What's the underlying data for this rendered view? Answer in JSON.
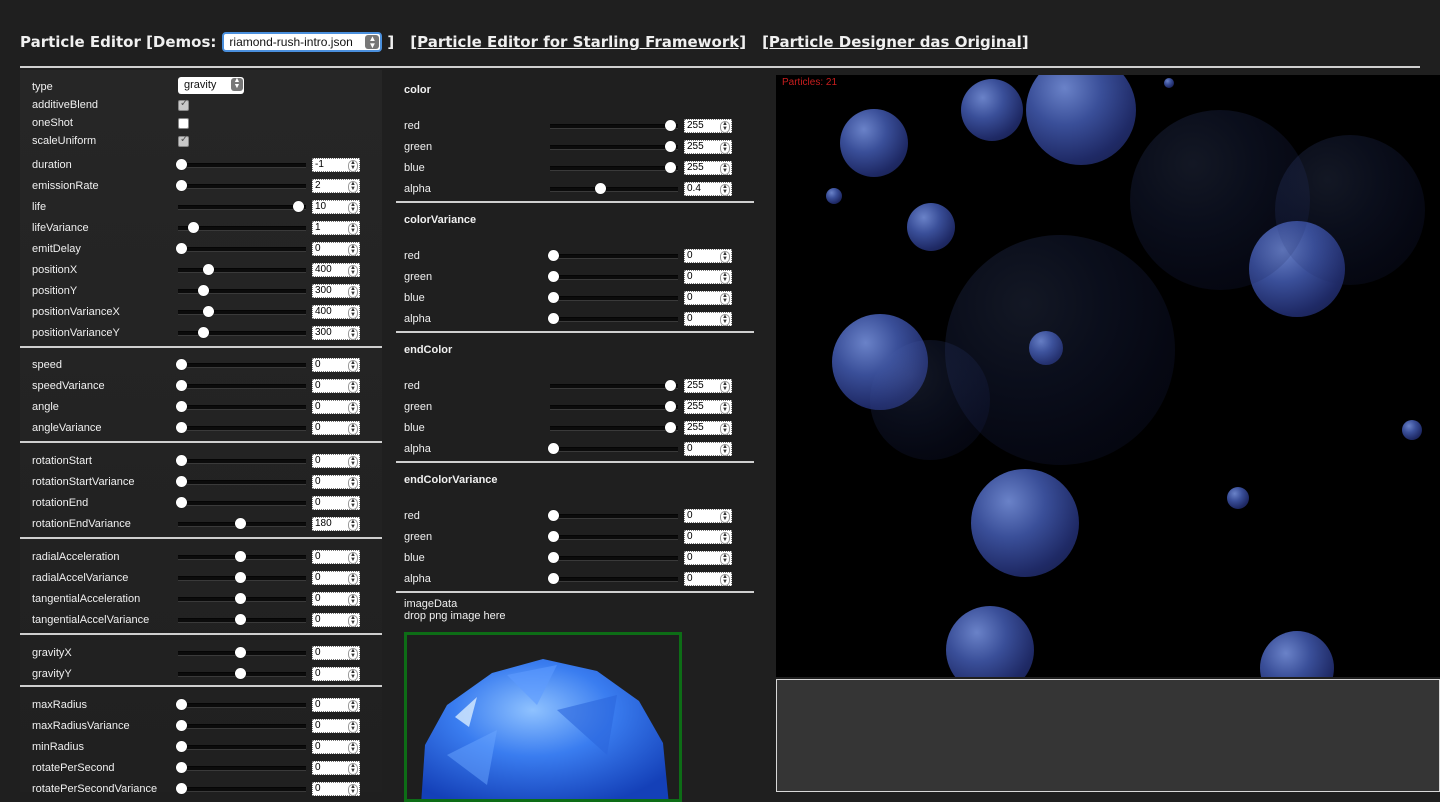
{
  "header": {
    "title_prefix": "Particle Editor [Demos:",
    "demo_selected": "riamond-rush-intro.json",
    "close_bracket": "]",
    "link1": "[Particle Editor for Starling Framework]",
    "link2": "[Particle Designer das Original]"
  },
  "left": {
    "type": {
      "label": "type",
      "value": "gravity"
    },
    "checks": [
      {
        "label": "additiveBlend",
        "checked": true
      },
      {
        "label": "oneShot",
        "checked": false
      },
      {
        "label": "scaleUniform",
        "checked": true
      }
    ],
    "groups": [
      [
        {
          "label": "duration",
          "value": "-1",
          "slider": 0.0
        },
        {
          "label": "emissionRate",
          "value": "2",
          "slider": 0.0
        },
        {
          "label": "life",
          "value": "10",
          "slider": 1.0
        },
        {
          "label": "lifeVariance",
          "value": "1",
          "slider": 0.1
        },
        {
          "label": "emitDelay",
          "value": "0",
          "slider": 0.0
        },
        {
          "label": "positionX",
          "value": "400",
          "slider": 0.23
        },
        {
          "label": "positionY",
          "value": "300",
          "slider": 0.19
        },
        {
          "label": "positionVarianceX",
          "value": "400",
          "slider": 0.23
        },
        {
          "label": "positionVarianceY",
          "value": "300",
          "slider": 0.19
        }
      ],
      [
        {
          "label": "speed",
          "value": "0",
          "slider": 0.0
        },
        {
          "label": "speedVariance",
          "value": "0",
          "slider": 0.0
        },
        {
          "label": "angle",
          "value": "0",
          "slider": 0.0
        },
        {
          "label": "angleVariance",
          "value": "0",
          "slider": 0.0
        }
      ],
      [
        {
          "label": "rotationStart",
          "value": "0",
          "slider": 0.0
        },
        {
          "label": "rotationStartVariance",
          "value": "0",
          "slider": 0.0
        },
        {
          "label": "rotationEnd",
          "value": "0",
          "slider": 0.0
        },
        {
          "label": "rotationEndVariance",
          "value": "180",
          "slider": 0.5
        }
      ],
      [
        {
          "label": "radialAcceleration",
          "value": "0",
          "slider": 0.5
        },
        {
          "label": "radialAccelVariance",
          "value": "0",
          "slider": 0.5
        },
        {
          "label": "tangentialAcceleration",
          "value": "0",
          "slider": 0.5
        },
        {
          "label": "tangentialAccelVariance",
          "value": "0",
          "slider": 0.5
        }
      ],
      [
        {
          "label": "gravityX",
          "value": "0",
          "slider": 0.5
        },
        {
          "label": "gravityY",
          "value": "0",
          "slider": 0.5
        }
      ],
      [
        {
          "label": "maxRadius",
          "value": "0",
          "slider": 0.0
        },
        {
          "label": "maxRadiusVariance",
          "value": "0",
          "slider": 0.0
        },
        {
          "label": "minRadius",
          "value": "0",
          "slider": 0.0
        },
        {
          "label": "rotatePerSecond",
          "value": "0",
          "slider": 0.0
        },
        {
          "label": "rotatePerSecondVariance",
          "value": "0",
          "slider": 0.0
        }
      ]
    ]
  },
  "mid": {
    "sections": [
      {
        "title": "color",
        "rows": [
          {
            "label": "red",
            "value": "255",
            "slider": 1.0
          },
          {
            "label": "green",
            "value": "255",
            "slider": 1.0
          },
          {
            "label": "blue",
            "value": "255",
            "slider": 1.0
          },
          {
            "label": "alpha",
            "value": "0.4",
            "slider": 0.4
          }
        ]
      },
      {
        "title": "colorVariance",
        "rows": [
          {
            "label": "red",
            "value": "0",
            "slider": 0.0
          },
          {
            "label": "green",
            "value": "0",
            "slider": 0.0
          },
          {
            "label": "blue",
            "value": "0",
            "slider": 0.0
          },
          {
            "label": "alpha",
            "value": "0",
            "slider": 0.0
          }
        ]
      },
      {
        "title": "endColor",
        "rows": [
          {
            "label": "red",
            "value": "255",
            "slider": 1.0
          },
          {
            "label": "green",
            "value": "255",
            "slider": 1.0
          },
          {
            "label": "blue",
            "value": "255",
            "slider": 1.0
          },
          {
            "label": "alpha",
            "value": "0",
            "slider": 0.0
          }
        ]
      },
      {
        "title": "endColorVariance",
        "rows": [
          {
            "label": "red",
            "value": "0",
            "slider": 0.0
          },
          {
            "label": "green",
            "value": "0",
            "slider": 0.0
          },
          {
            "label": "blue",
            "value": "0",
            "slider": 0.0
          },
          {
            "label": "alpha",
            "value": "0",
            "slider": 0.0
          }
        ]
      }
    ],
    "image_title": "imageData",
    "image_hint": "drop png image here"
  },
  "canvas": {
    "particle_count": "Particles: 21",
    "count_color": "#c81e1e",
    "gem_color": "#3a4f99"
  },
  "colors": {
    "background": "#1f1f1f",
    "drop_border": "#0d6d16",
    "canvas_bg": "#000000"
  }
}
